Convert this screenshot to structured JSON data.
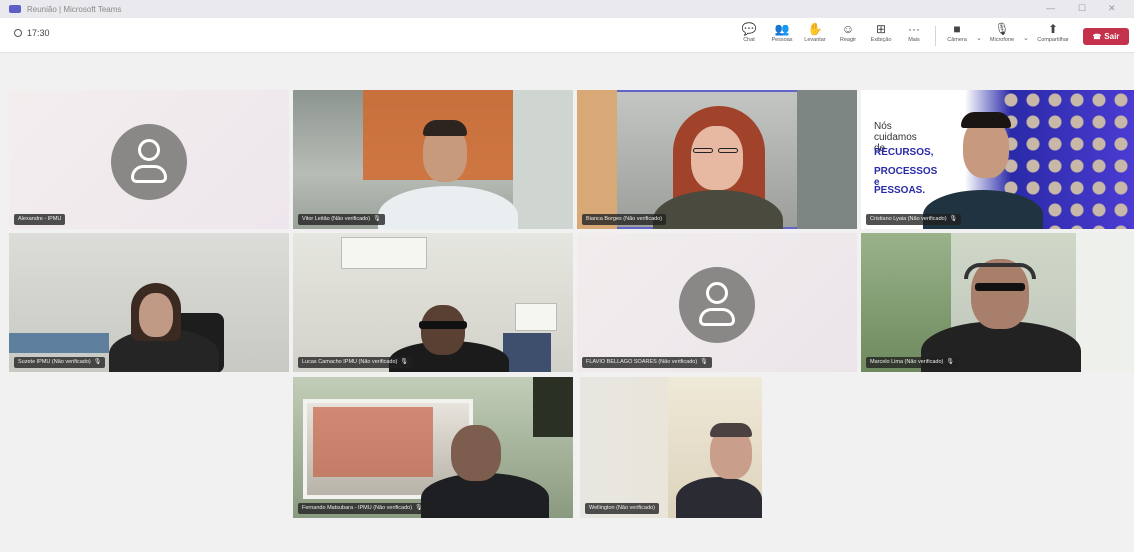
{
  "window": {
    "title": "Reunião | Microsoft Teams"
  },
  "toolbar": {
    "timer": "17:30",
    "buttons": [
      {
        "label": "Chat",
        "icon": "chat-icon",
        "glyph": "💬"
      },
      {
        "label": "Pessoas",
        "icon": "people-icon",
        "glyph": "👥"
      },
      {
        "label": "Levantar",
        "icon": "raise-hand-icon",
        "glyph": "✋"
      },
      {
        "label": "Reagir",
        "icon": "react-icon",
        "glyph": "☺"
      },
      {
        "label": "Exibição",
        "icon": "view-icon",
        "glyph": "⊞"
      },
      {
        "label": "Mais",
        "icon": "more-icon",
        "glyph": "···"
      },
      {
        "label": "Câmera",
        "icon": "camera-icon",
        "glyph": "■"
      },
      {
        "label": "Microfone",
        "icon": "microphone-icon",
        "glyph": "🎙"
      },
      {
        "label": "Compartilhar",
        "icon": "share-icon",
        "glyph": "⬆"
      }
    ],
    "leave_label": "Sair"
  },
  "tiles": [
    {
      "name": "Alexandre - IPMU"
    },
    {
      "name": "Vitor Leitão (Não verificado)"
    },
    {
      "name": "Bianca Borges (Não verificado)"
    },
    {
      "name": "Cristiano Lyaia (Não verificado)"
    },
    {
      "name": "Suzete IPMU (Não verificado)"
    },
    {
      "name": "Lucas Camacho IPMU (Não verificado)"
    },
    {
      "name": "FLAVIO BELLAGO SOARES (Não verificado)"
    },
    {
      "name": "Marcelo Lima (Não verificado)"
    },
    {
      "name": "Fernando Matsubara - IPMU (Não verificado)"
    },
    {
      "name": "Wellington (Não verificado)"
    }
  ],
  "banner": {
    "line1": "Nós cuidamos de",
    "line2": "RECURSOS,",
    "line3": "PROCESSOS e",
    "line4": "PESSOAS."
  },
  "colors": {
    "accent": "#5b5fc7",
    "leave": "#c4314b",
    "avatar": "#8a8886"
  }
}
